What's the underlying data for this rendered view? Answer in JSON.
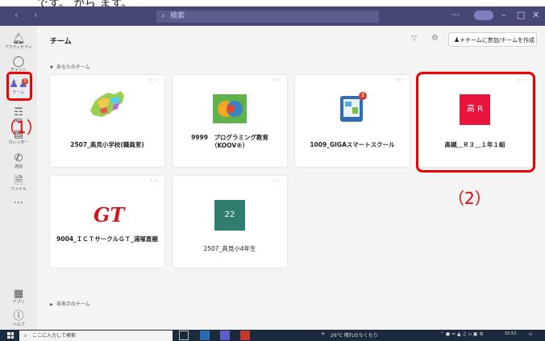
{
  "top_text": "です。        から       ます。",
  "window": {
    "nav_arrows": "‹ ›",
    "search_placeholder": "検索",
    "controls": {
      "more": "···",
      "minimize": "–",
      "maximize": "□",
      "close": "✕"
    }
  },
  "rail": {
    "items": [
      {
        "icon": "bell",
        "label": "アクティビティ"
      },
      {
        "icon": "chat",
        "label": "チャット"
      },
      {
        "icon": "teams",
        "label": "チーム"
      },
      {
        "icon": "assignments",
        "label": "課題"
      },
      {
        "icon": "calendar",
        "label": "カレンダー"
      },
      {
        "icon": "calls",
        "label": "通話"
      },
      {
        "icon": "files",
        "label": "ファイル"
      },
      {
        "icon": "more",
        "label": "···"
      }
    ],
    "bottom": [
      {
        "icon": "apps",
        "label": "アプリ"
      },
      {
        "icon": "help",
        "label": "ヘルプ"
      }
    ],
    "teams_badge": "3"
  },
  "annotations": {
    "one": "（1）",
    "two": "（2）"
  },
  "main": {
    "title": "チーム",
    "join_button": "チームに参加/チームを作成",
    "section_your_teams": "あなたのチーム",
    "section_hidden": "非表示のチーム",
    "cards": [
      {
        "name": "2507_高見小学校(職員室)",
        "avatar_type": "image-map"
      },
      {
        "name": "9999　プログラミング教育（KOOV®）",
        "avatar_type": "image-chat"
      },
      {
        "name": "1009_GIGAスマートスクール",
        "avatar_type": "image-phone",
        "avatar_badge": "1"
      },
      {
        "name": "高槻＿Ｒ３＿１年１組",
        "avatar_type": "initials",
        "avatar_text": "高 R",
        "avatar_color": "#e8143b"
      },
      {
        "name": "9004_ＩＣＴサークルＧＴ_浦塚直樹",
        "avatar_type": "logo-gt",
        "avatar_text": "GT"
      },
      {
        "name": "2507_高見小4年生",
        "avatar_type": "initials",
        "avatar_text": "22",
        "avatar_color": "#2e7d6d"
      }
    ]
  },
  "taskbar": {
    "search_placeholder": "ここに入力して検索",
    "weather": "26°C  晴れのちくもり",
    "time": "10:53"
  },
  "colors": {
    "titlebar": "#464775",
    "accent": "#5b5fc7",
    "annotation": "#e00000"
  }
}
